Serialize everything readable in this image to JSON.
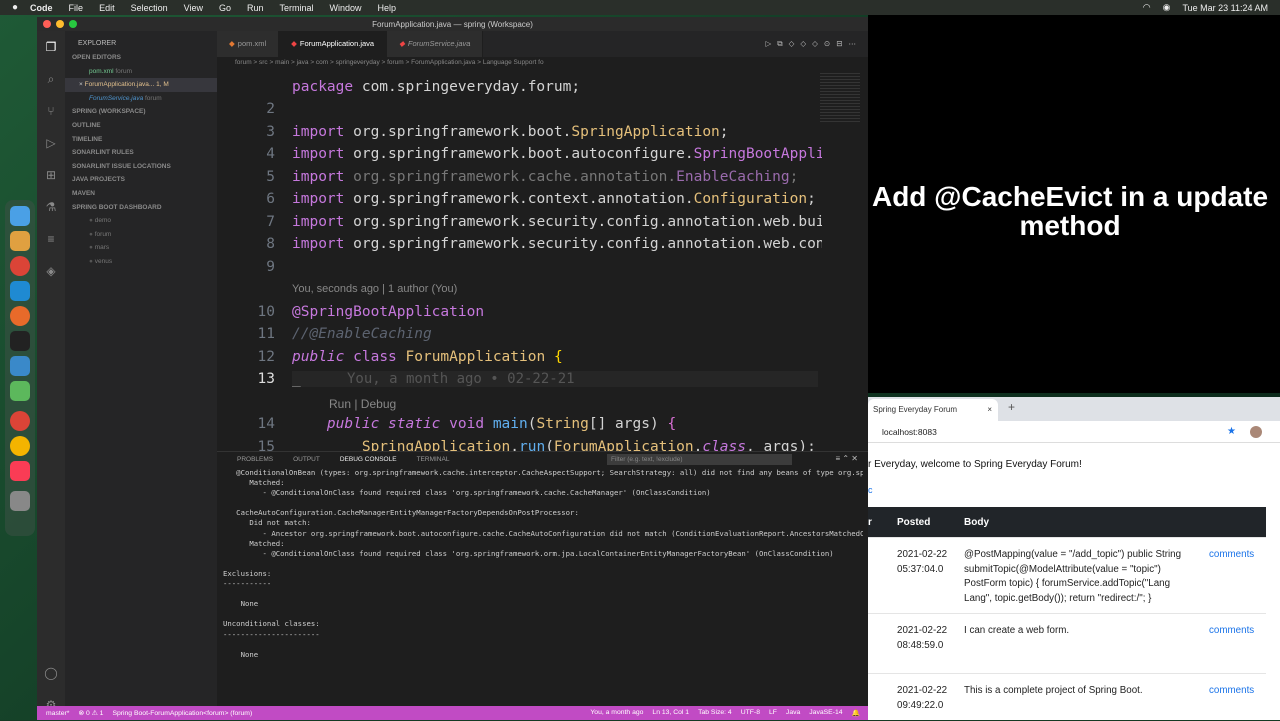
{
  "menubar": {
    "apple": "",
    "app": "Code",
    "items": [
      "File",
      "Edit",
      "Selection",
      "View",
      "Go",
      "Run",
      "Terminal",
      "Window",
      "Help"
    ],
    "datetime": "Tue Mar 23  11:24 AM"
  },
  "window": {
    "title": "ForumApplication.java — spring (Workspace)"
  },
  "overlay": {
    "text": "Add @CacheEvict in a update method"
  },
  "sidebar": {
    "header": "EXPLORER",
    "open_editors": "OPEN EDITORS",
    "files": [
      {
        "name": "pom.xml",
        "detail": "forum",
        "badge": "M",
        "color": "#73c991"
      },
      {
        "name": "ForumApplication.java...",
        "detail": "1, M",
        "badge": "",
        "color": "#e2c08d"
      },
      {
        "name": "ForumService.java",
        "detail": "forum",
        "badge": "M",
        "color": "#4e94ce"
      }
    ],
    "sections": [
      "SPRING (WORKSPACE)",
      "OUTLINE",
      "TIMELINE",
      "SONARLINT RULES",
      "SONARLINT ISSUE LOCATIONS",
      "JAVA PROJECTS",
      "MAVEN",
      "SPRING BOOT DASHBOARD"
    ],
    "boot_apps": [
      "demo",
      "forum",
      "mars",
      "venus"
    ]
  },
  "tabs": [
    {
      "label": "pom.xml",
      "active": false
    },
    {
      "label": "ForumApplication.java",
      "active": true
    },
    {
      "label": "ForumService.java",
      "active": false
    }
  ],
  "breadcrumb": "forum  >  src  >  main  >  java  >  com  >  springeveryday  >  forum  >  ForumApplication.java  >  Language Support fo",
  "code": {
    "blame_hint": "You, seconds ago | 1 author (You)",
    "codelens": "Run | Debug",
    "ghost": "You, a month ago • 02-22-21"
  },
  "panel": {
    "tabs": [
      "PROBLEMS",
      "OUTPUT",
      "DEBUG CONSOLE",
      "TERMINAL"
    ],
    "filter_placeholder": "Filter (e.g. text, !exclude)",
    "terminal": "   @ConditionalOnBean (types: org.springframework.cache.interceptor.CacheAspectSupport; SearchStrategy: all) did not find any beans of type org.springframework.cache.interceptor.CacheAspectSupport (OnBeanCondition)\n      Matched:\n         - @ConditionalOnClass found required class 'org.springframework.cache.CacheManager' (OnClassCondition)\n\n   CacheAutoConfiguration.CacheManagerEntityManagerFactoryDependsOnPostProcessor:\n      Did not match:\n         - Ancestor org.springframework.boot.autoconfigure.cache.CacheAutoConfiguration did not match (ConditionEvaluationReport.AncestorsMatchedCondition)\n      Matched:\n         - @ConditionalOnClass found required class 'org.springframework.orm.jpa.LocalContainerEntityManagerFactoryBean' (OnClassCondition)\n\nExclusions:\n-----------\n\n    None\n\nUnconditional classes:\n----------------------\n\n    None\n"
  },
  "statusbar": {
    "branch": "master*",
    "errors": "⊗ 0 ⚠ 1",
    "run": "Spring Boot-ForumApplication<forum> (forum)",
    "blame": "You, a month ago",
    "position": "Ln 13, Col 1",
    "tabsize": "Tab Size: 4",
    "encoding": "UTF-8",
    "eol": "LF",
    "lang": "Java",
    "jdk": "JavaSE-14"
  },
  "browser": {
    "tab_title": "Spring Everyday Forum",
    "url": "localhost:8083",
    "welcome": "r Everyday, welcome to Spring Everyday Forum!",
    "link_fragment": "c",
    "headers": [
      "r",
      "Posted",
      "Body"
    ],
    "rows": [
      {
        "posted": "2021-02-22 05:37:04.0",
        "body": "@PostMapping(value = \"/add_topic\") public String submitTopic(@ModelAttribute(value = \"topic\") PostForm topic) { forumService.addTopic(\"Lang Lang\", topic.getBody()); return \"redirect:/\"; }",
        "link": "comments"
      },
      {
        "posted": "2021-02-22 08:48:59.0",
        "body": "I can create a web form.",
        "link": "comments"
      },
      {
        "posted": "2021-02-22 09:49:22.0",
        "body": "This is a complete project of Spring Boot.",
        "link": "comments"
      }
    ]
  }
}
